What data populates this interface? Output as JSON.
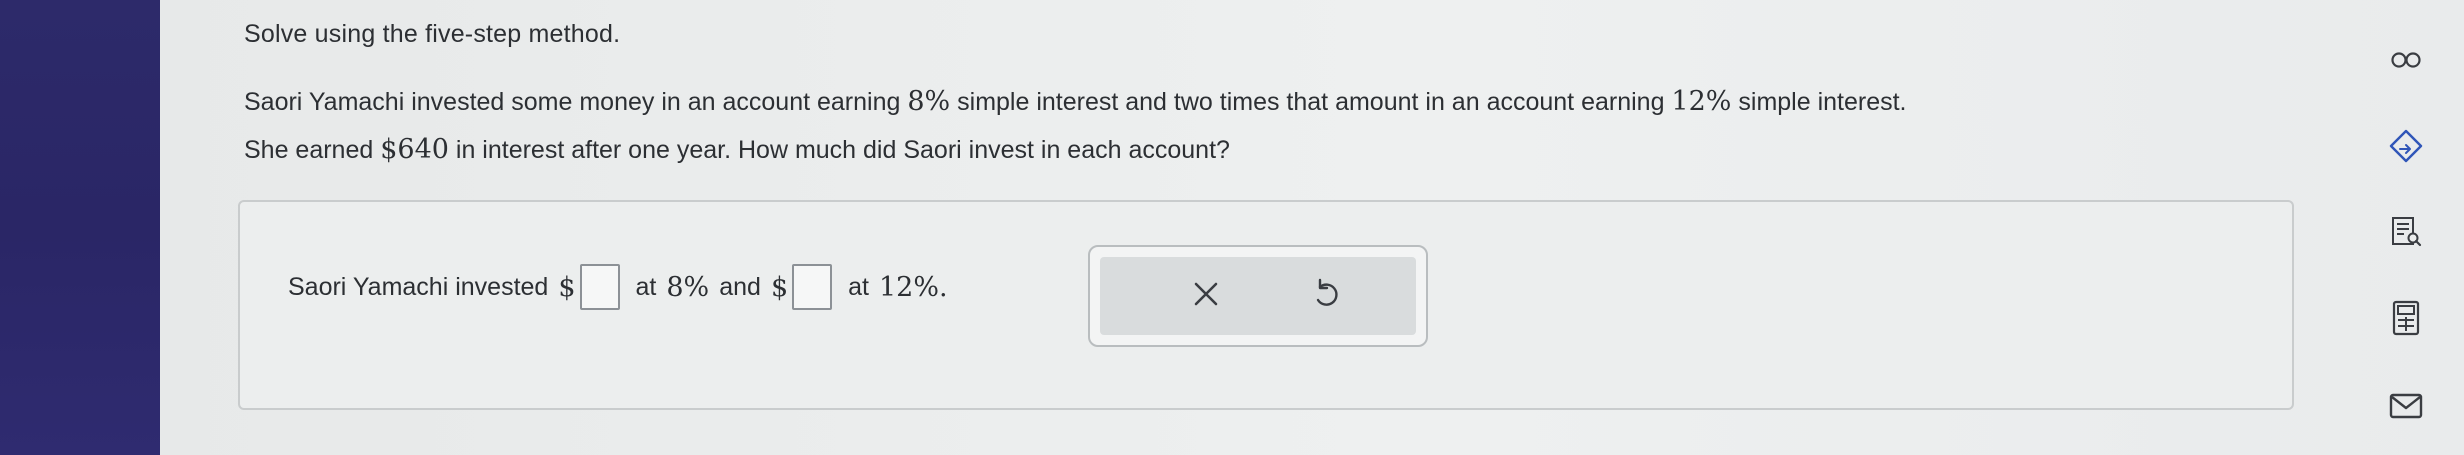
{
  "instruction": "Solve using the five-step method.",
  "problem": {
    "part1": "Saori Yamachi invested some money in an account earning ",
    "rate1": "8%",
    "part2": " simple interest and two times that amount in an account earning ",
    "rate2": "12%",
    "part3": " simple interest.",
    "part4": "She earned ",
    "amount": "$640",
    "part5": " in interest after one year. How much did Saori invest in each account?"
  },
  "answer": {
    "prefix": "Saori Yamachi invested",
    "dollar1": "$",
    "at_text": "at",
    "rate1": "8%",
    "and_text": "and",
    "dollar2": "$",
    "rate2": "12%.",
    "input1_value": "",
    "input2_value": ""
  },
  "tools": {
    "clear_icon": "x-icon",
    "undo_icon": "undo-icon"
  },
  "right_rail": [
    {
      "icon": "infinity-icon"
    },
    {
      "icon": "tag-arrow-icon"
    },
    {
      "icon": "list-search-icon"
    },
    {
      "icon": "calculator-icon"
    },
    {
      "icon": "mail-icon"
    }
  ],
  "colors": {
    "left_band": "#2d2a6a",
    "accent": "#2c3e99",
    "text": "#2c2f33"
  }
}
